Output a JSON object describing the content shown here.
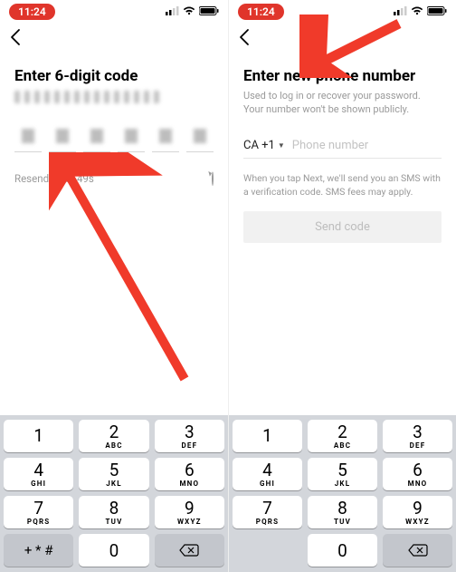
{
  "status": {
    "time": "11:24"
  },
  "left": {
    "title": "Enter 6-digit code",
    "resend_label": "Resend code",
    "resend_timer": "49s"
  },
  "right": {
    "title": "Enter new phone number",
    "subtitle": "Used to log in or recover your password. Your number won't be shown publicly.",
    "country_code": "CA +1",
    "phone_placeholder": "Phone number",
    "sms_note": "When you tap Next, we'll send you an SMS with a verification code. SMS fees may apply.",
    "send_button": "Send code"
  },
  "keypad": {
    "k1": {
      "num": "1",
      "letters": ""
    },
    "k2": {
      "num": "2",
      "letters": "ABC"
    },
    "k3": {
      "num": "3",
      "letters": "DEF"
    },
    "k4": {
      "num": "4",
      "letters": "GHI"
    },
    "k5": {
      "num": "5",
      "letters": "JKL"
    },
    "k6": {
      "num": "6",
      "letters": "MNO"
    },
    "k7": {
      "num": "7",
      "letters": "PQRS"
    },
    "k8": {
      "num": "8",
      "letters": "TUV"
    },
    "k9": {
      "num": "9",
      "letters": "WXYZ"
    },
    "k0": {
      "num": "0",
      "letters": ""
    },
    "sym": "+ * #"
  }
}
